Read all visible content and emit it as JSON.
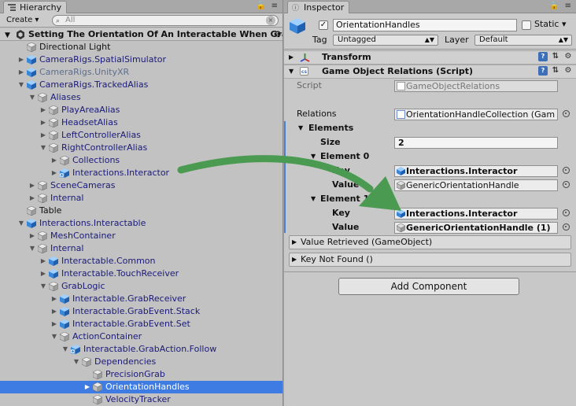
{
  "hierarchy": {
    "tab_label": "Hierarchy",
    "create_label": "Create ▾",
    "search_placeholder": "All",
    "scene_title": "Setting The Orientation Of An Interactable When Grabbed",
    "rows": [
      {
        "label": "Directional Light",
        "icon": "gameobject-icon"
      },
      {
        "label": "CameraRigs.SpatialSimulator",
        "icon": "prefab-icon"
      },
      {
        "label": "CameraRigs.UnityXR",
        "icon": "prefab-icon"
      },
      {
        "label": "CameraRigs.TrackedAlias",
        "icon": "prefab-icon"
      },
      {
        "label": "Aliases",
        "icon": "gameobject-icon"
      },
      {
        "label": "PlayAreaAlias",
        "icon": "gameobject-icon"
      },
      {
        "label": "HeadsetAlias",
        "icon": "gameobject-icon"
      },
      {
        "label": "LeftControllerAlias",
        "icon": "gameobject-icon"
      },
      {
        "label": "RightControllerAlias",
        "icon": "gameobject-icon"
      },
      {
        "label": "Collections",
        "icon": "gameobject-icon"
      },
      {
        "label": "Interactions.Interactor",
        "icon": "prefab-add-icon"
      },
      {
        "label": "SceneCameras",
        "icon": "gameobject-icon"
      },
      {
        "label": "Internal",
        "icon": "gameobject-icon"
      },
      {
        "label": "Table",
        "icon": "gameobject-icon"
      },
      {
        "label": "Interactions.Interactable",
        "icon": "prefab-icon"
      },
      {
        "label": "MeshContainer",
        "icon": "gameobject-icon"
      },
      {
        "label": "Internal",
        "icon": "gameobject-icon"
      },
      {
        "label": "Interactable.Common",
        "icon": "prefab-icon"
      },
      {
        "label": "Interactable.TouchReceiver",
        "icon": "prefab-icon"
      },
      {
        "label": "GrabLogic",
        "icon": "gameobject-icon"
      },
      {
        "label": "Interactable.GrabReceiver",
        "icon": "prefab-icon"
      },
      {
        "label": "Interactable.GrabEvent.Stack",
        "icon": "prefab-icon"
      },
      {
        "label": "Interactable.GrabEvent.Set",
        "icon": "prefab-icon"
      },
      {
        "label": "ActionContainer",
        "icon": "gameobject-icon"
      },
      {
        "label": "Interactable.GrabAction.Follow",
        "icon": "prefab-add-icon"
      },
      {
        "label": "Dependencies",
        "icon": "gameobject-icon"
      },
      {
        "label": "PrecisionGrab",
        "icon": "gameobject-icon"
      },
      {
        "label": "OrientationHandles",
        "icon": "gameobject-icon"
      },
      {
        "label": "VelocityTracker",
        "icon": "gameobject-icon"
      }
    ]
  },
  "inspector": {
    "tab_label": "Inspector",
    "object_name": "OrientationHandles",
    "static_label": "Static ▾",
    "tag_label": "Tag",
    "tag_value": "Untagged",
    "layer_label": "Layer",
    "layer_value": "Default",
    "transform_label": "Transform",
    "component_label": "Game Object Relations (Script)",
    "script_label": "Script",
    "script_value": "GameObjectRelations",
    "relations_label": "Relations",
    "relations_value": "OrientationHandleCollection (Gam",
    "elements_label": "Elements",
    "size_label": "Size",
    "size_value": "2",
    "element0_label": "Element 0",
    "element0_key_label": "Key",
    "element0_key_value": "Interactions.Interactor",
    "element0_value_label": "Value",
    "element0_value_value": "GenericOrientationHandle",
    "element1_label": "Element 1",
    "element1_key_label": "Key",
    "element1_key_value": "Interactions.Interactor",
    "element1_value_label": "Value",
    "element1_value_value": "GenericOrientationHandle (1)",
    "event1_label": "Value Retrieved (GameObject)",
    "event2_label": "Key Not Found ()",
    "add_component_label": "Add Component"
  },
  "colors": {
    "selection": "#3e7ce4",
    "prefab_text": "#1a1a7a",
    "arrow_green": "#4a9a52"
  }
}
